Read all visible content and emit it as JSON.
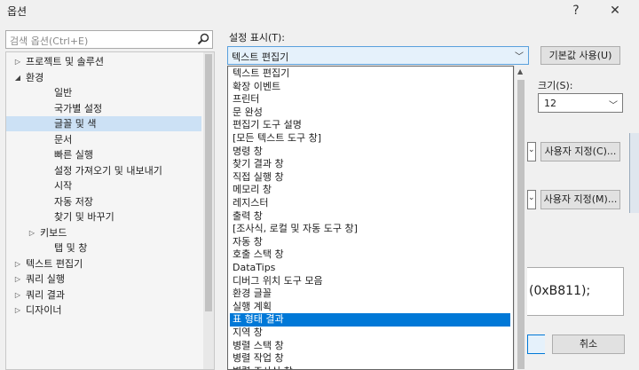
{
  "window": {
    "title": "옵션",
    "help_label": "?",
    "close_label": "✕"
  },
  "search": {
    "placeholder": "검색 옵션(Ctrl+E)",
    "icon": "search-icon"
  },
  "tree": {
    "items": [
      {
        "label": "프로젝트 및 솔루션",
        "arrow": "▷",
        "indent": 0
      },
      {
        "label": "환경",
        "arrow": "◢",
        "indent": 0
      },
      {
        "label": "일반",
        "arrow": "",
        "indent": 2
      },
      {
        "label": "국가별 설정",
        "arrow": "",
        "indent": 2
      },
      {
        "label": "글꼴 및 색",
        "arrow": "",
        "indent": 2,
        "selected": true
      },
      {
        "label": "문서",
        "arrow": "",
        "indent": 2
      },
      {
        "label": "빠른 실행",
        "arrow": "",
        "indent": 2
      },
      {
        "label": "설정 가져오기 및 내보내기",
        "arrow": "",
        "indent": 2
      },
      {
        "label": "시작",
        "arrow": "",
        "indent": 2
      },
      {
        "label": "자동 저장",
        "arrow": "",
        "indent": 2
      },
      {
        "label": "찾기 및 바꾸기",
        "arrow": "",
        "indent": 2
      },
      {
        "label": "키보드",
        "arrow": "▷",
        "indent": 1
      },
      {
        "label": "탭 및 창",
        "arrow": "",
        "indent": 2
      },
      {
        "label": "텍스트 편집기",
        "arrow": "▷",
        "indent": 0
      },
      {
        "label": "쿼리 실행",
        "arrow": "▷",
        "indent": 0
      },
      {
        "label": "쿼리 결과",
        "arrow": "▷",
        "indent": 0
      },
      {
        "label": "디자이너",
        "arrow": "▷",
        "indent": 0
      }
    ]
  },
  "settings": {
    "show_label": "설정 표시(T):",
    "selected_value": "텍스트 편집기",
    "default_button": "기본값 사용(U)",
    "size_label": "크기(S):",
    "size_value": "12",
    "custom_button_1": "사용자 지정(C)...",
    "custom_button_2": "사용자 지정(M)...",
    "preview_text": "(0xB811);",
    "cancel_button": "취소"
  },
  "dropdown": {
    "items": [
      "텍스트 편집기",
      "확장 이벤트",
      "프린터",
      "문 완성",
      "편집기 도구 설명",
      "[모든 텍스트 도구 창]",
      "명령 창",
      "찾기 결과 창",
      "직접 실행 창",
      "메모리 창",
      "레지스터",
      "출력 창",
      "[조사식, 로컬 및 자동 도구 창]",
      "자동 창",
      "호출 스택 창",
      "DataTips",
      "디버그 위치 도구 모음",
      "환경 글꼴",
      "실행 계획",
      "표 형태 결과",
      "지역 창",
      "병렬 스택 창",
      "병렬 작업 창",
      "병렬 조사식 창"
    ],
    "selected_index": 19
  },
  "colors": {
    "selection": "#0078d7",
    "tree_selection": "#cce1f5",
    "combo_border": "#5aa0dc"
  }
}
